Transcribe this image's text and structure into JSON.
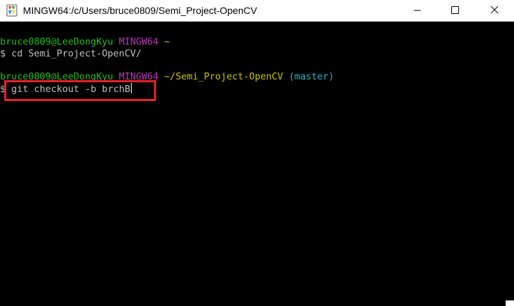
{
  "window": {
    "title": "MINGW64:/c/Users/bruce0809/Semi_Project-OpenCV"
  },
  "terminal": {
    "prompt1": {
      "user_host": "bruce0809@LeeDongKyu",
      "shell": "MINGW64",
      "path": "~"
    },
    "command1": "$ cd Semi_Project-OpenCV/",
    "prompt2": {
      "user_host": "bruce0809@LeeDongKyu",
      "shell": "MINGW64",
      "path": "~/Semi_Project-OpenCV",
      "branch": "(master)"
    },
    "command2": {
      "symbol": "$",
      "text": "git checkout -b brchB"
    }
  },
  "colors": {
    "user_host": "#1fbd1f",
    "shell": "#b83ab8",
    "path": "#c7c400",
    "branch": "#25b6c7",
    "highlight": "#e8202a"
  }
}
